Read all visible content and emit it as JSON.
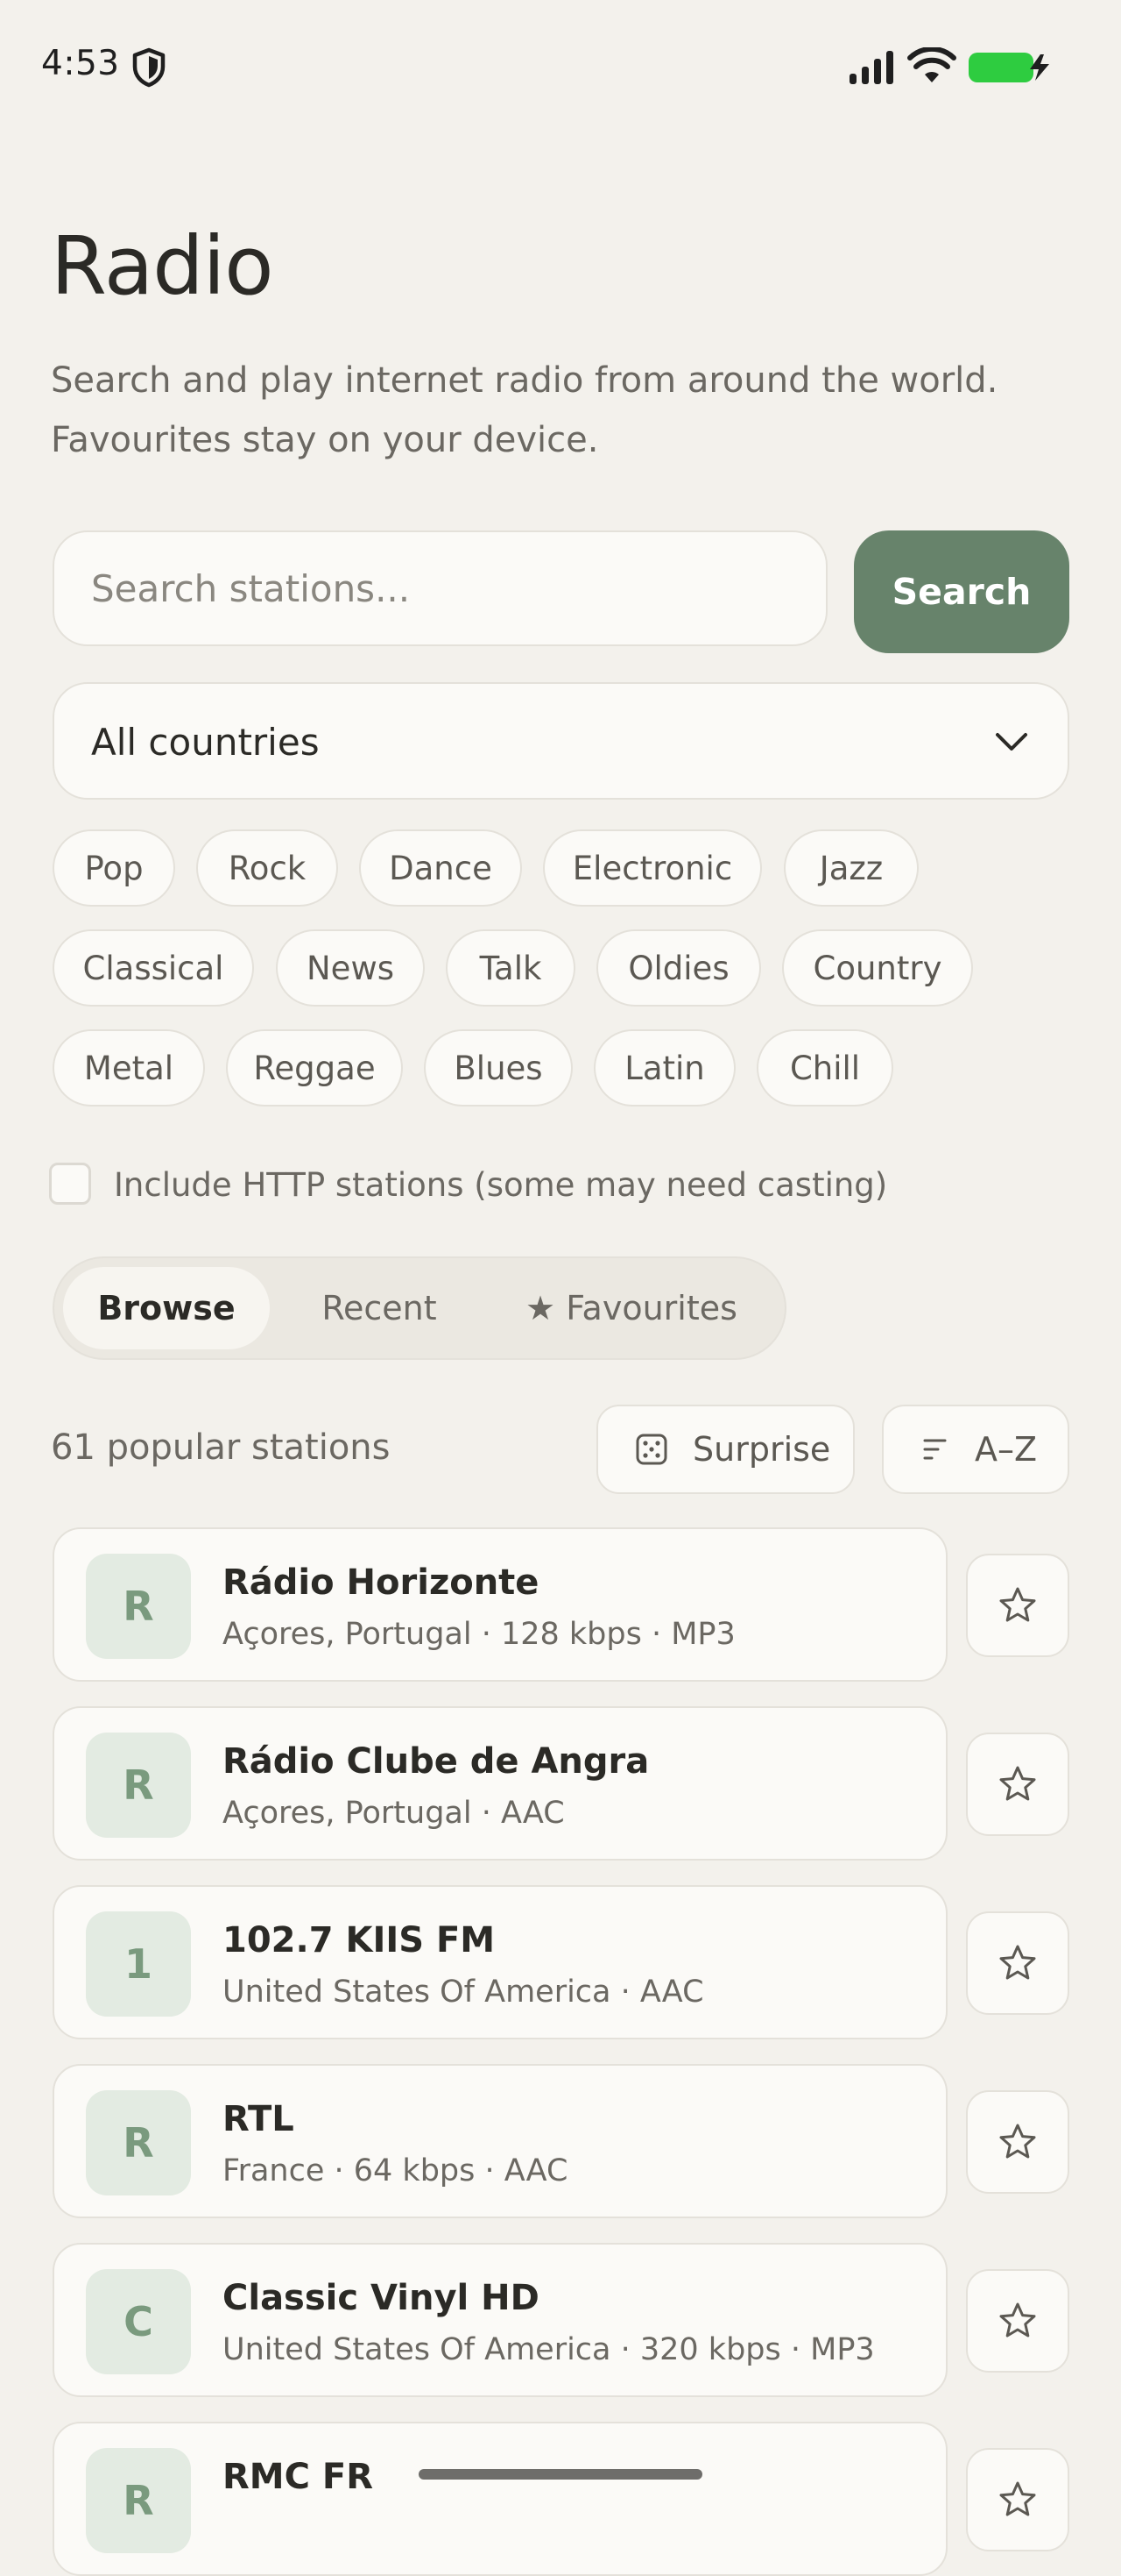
{
  "status_bar": {
    "time": "4:53",
    "icons": [
      "shield-icon",
      "signal-icon",
      "wifi-icon",
      "battery-charging-icon"
    ],
    "battery_color": "#2ecc40"
  },
  "header": {
    "title": "Radio",
    "subtitle_line1": "Search and play internet radio from around the world.",
    "subtitle_line2": "Favourites stay on your device."
  },
  "search": {
    "placeholder": "Search stations...",
    "value": "",
    "button_label": "Search",
    "accent_color": "#67836b"
  },
  "country_select": {
    "selected": "All countries"
  },
  "genres": [
    [
      "Pop",
      "Rock",
      "Dance",
      "Electronic",
      "Jazz"
    ],
    [
      "Classical",
      "News",
      "Talk",
      "Oldies",
      "Country"
    ],
    [
      "Metal",
      "Reggae",
      "Blues",
      "Latin",
      "Chill"
    ]
  ],
  "http_option": {
    "label": "Include HTTP stations (some may need casting)",
    "checked": false
  },
  "tabs": [
    {
      "label": "Browse",
      "active": true
    },
    {
      "label": "Recent",
      "active": false
    },
    {
      "label": "★ Favourites",
      "active": false
    }
  ],
  "list_header": {
    "count_text": "61 popular stations",
    "surprise_label": "Surprise",
    "sort_label": "A–Z"
  },
  "stations": [
    {
      "initial": "R",
      "name": "Rádio Horizonte",
      "meta": "Açores, Portugal · 128 kbps · MP3"
    },
    {
      "initial": "R",
      "name": "Rádio Clube de Angra",
      "meta": "Açores, Portugal · AAC"
    },
    {
      "initial": "1",
      "name": "102.7 KIIS FM",
      "meta": "United States Of America · AAC"
    },
    {
      "initial": "R",
      "name": "RTL",
      "meta": "France · 64 kbps · AAC"
    },
    {
      "initial": "C",
      "name": "Classic Vinyl HD",
      "meta": "United States Of America · 320 kbps · MP3"
    },
    {
      "initial": "R",
      "name": "RMC FR",
      "meta": ""
    }
  ]
}
